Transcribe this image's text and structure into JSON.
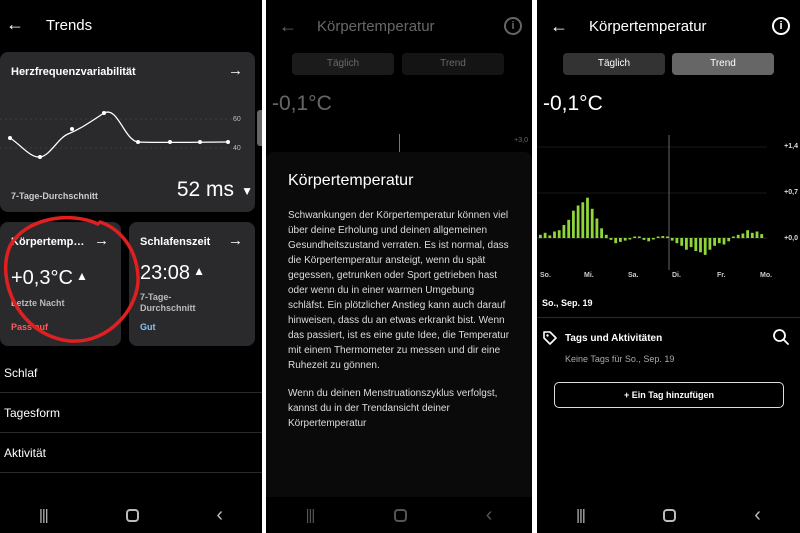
{
  "panel1": {
    "header": {
      "title": "Trends"
    },
    "hrv_card": {
      "title": "Herzfrequenzvariabilität",
      "axis_top": "60",
      "axis_bottom": "40",
      "subtitle": "7-Tage-Durchschnitt",
      "value": "52 ms",
      "trend_icon": "triangle-down"
    },
    "temp_card": {
      "title": "Körpertemp…",
      "value": "+0,3°C",
      "subtitle": "Letzte Nacht",
      "status": "Pass auf",
      "status_color": "#ff5a5a"
    },
    "sleep_card": {
      "title": "Schlafenszeit",
      "value": "23:08",
      "subtitle": "7-Tage-Durchschnitt",
      "status": "Gut",
      "status_color": "#7ec3ff"
    },
    "list": [
      "Schlaf",
      "Tagesform",
      "Aktivität"
    ]
  },
  "panel2": {
    "header": {
      "title": "Körpertemperatur"
    },
    "tabs": [
      "Täglich",
      "Trend"
    ],
    "value": "-0,1°C",
    "tick": "+3,0",
    "sheet": {
      "title": "Körpertemperatur",
      "paragraph1": "Schwankungen der Körpertemperatur können viel über deine Erholung und deinen allgemeinen Gesundheitszustand verraten. Es ist normal, dass die Körpertemperatur ansteigt, wenn du spät gegessen, getrunken oder Sport getrieben hast oder wenn du in einer warmen Umgebung schläfst. Ein plötzlicher Anstieg kann auch darauf hinweisen, dass du an etwas erkrankt bist. Wenn das passiert, ist es eine gute Idee, die Temperatur mit einem Thermometer zu messen und dir eine Ruhezeit zu gönnen.",
      "paragraph2": "Wenn du deinen Menstruationszyklus verfolgst, kannst du in der Trendansicht deiner Körpertemperatur"
    }
  },
  "panel3": {
    "header": {
      "title": "Körpertemperatur"
    },
    "tabs": [
      "Täglich",
      "Trend"
    ],
    "active_tab": "Trend",
    "value": "-0,1°C",
    "chart": {
      "y_ticks": [
        "+1,4",
        "+0,7",
        "+0,0"
      ],
      "x_labels": [
        "So.",
        "Mi.",
        "Sa.",
        "Di.",
        "Fr.",
        "Mo."
      ],
      "bar_color": "#8ed63a"
    },
    "selected_date": "So., Sep. 19",
    "tags": {
      "title": "Tags und Aktivitäten",
      "empty_text": "Keine Tags für So., Sep. 19",
      "add_button": "+ Ein Tag hinzufügen"
    }
  },
  "chart_data": {
    "type": "bar",
    "ylim": [
      -0.35,
      1.4
    ],
    "y_ticks": [
      "+1,4",
      "+0,7",
      "+0,0"
    ],
    "x_labels": [
      "So.",
      "Mi.",
      "Sa.",
      "Di.",
      "Fr.",
      "Mo."
    ],
    "values": [
      0.05,
      0.08,
      0.04,
      0.1,
      0.12,
      0.2,
      0.28,
      0.42,
      0.5,
      0.55,
      0.62,
      0.45,
      0.3,
      0.15,
      0.05,
      -0.03,
      -0.08,
      -0.06,
      -0.04,
      -0.02,
      0,
      0.02,
      -0.03,
      -0.05,
      -0.02,
      0.01,
      0.03,
      0,
      -0.04,
      -0.08,
      -0.12,
      -0.18,
      -0.14,
      -0.2,
      -0.22,
      -0.26,
      -0.18,
      -0.12,
      -0.08,
      -0.1,
      -0.05,
      0.02,
      0.05,
      0.07,
      0.12,
      0.08,
      0.1,
      0.06
    ]
  }
}
